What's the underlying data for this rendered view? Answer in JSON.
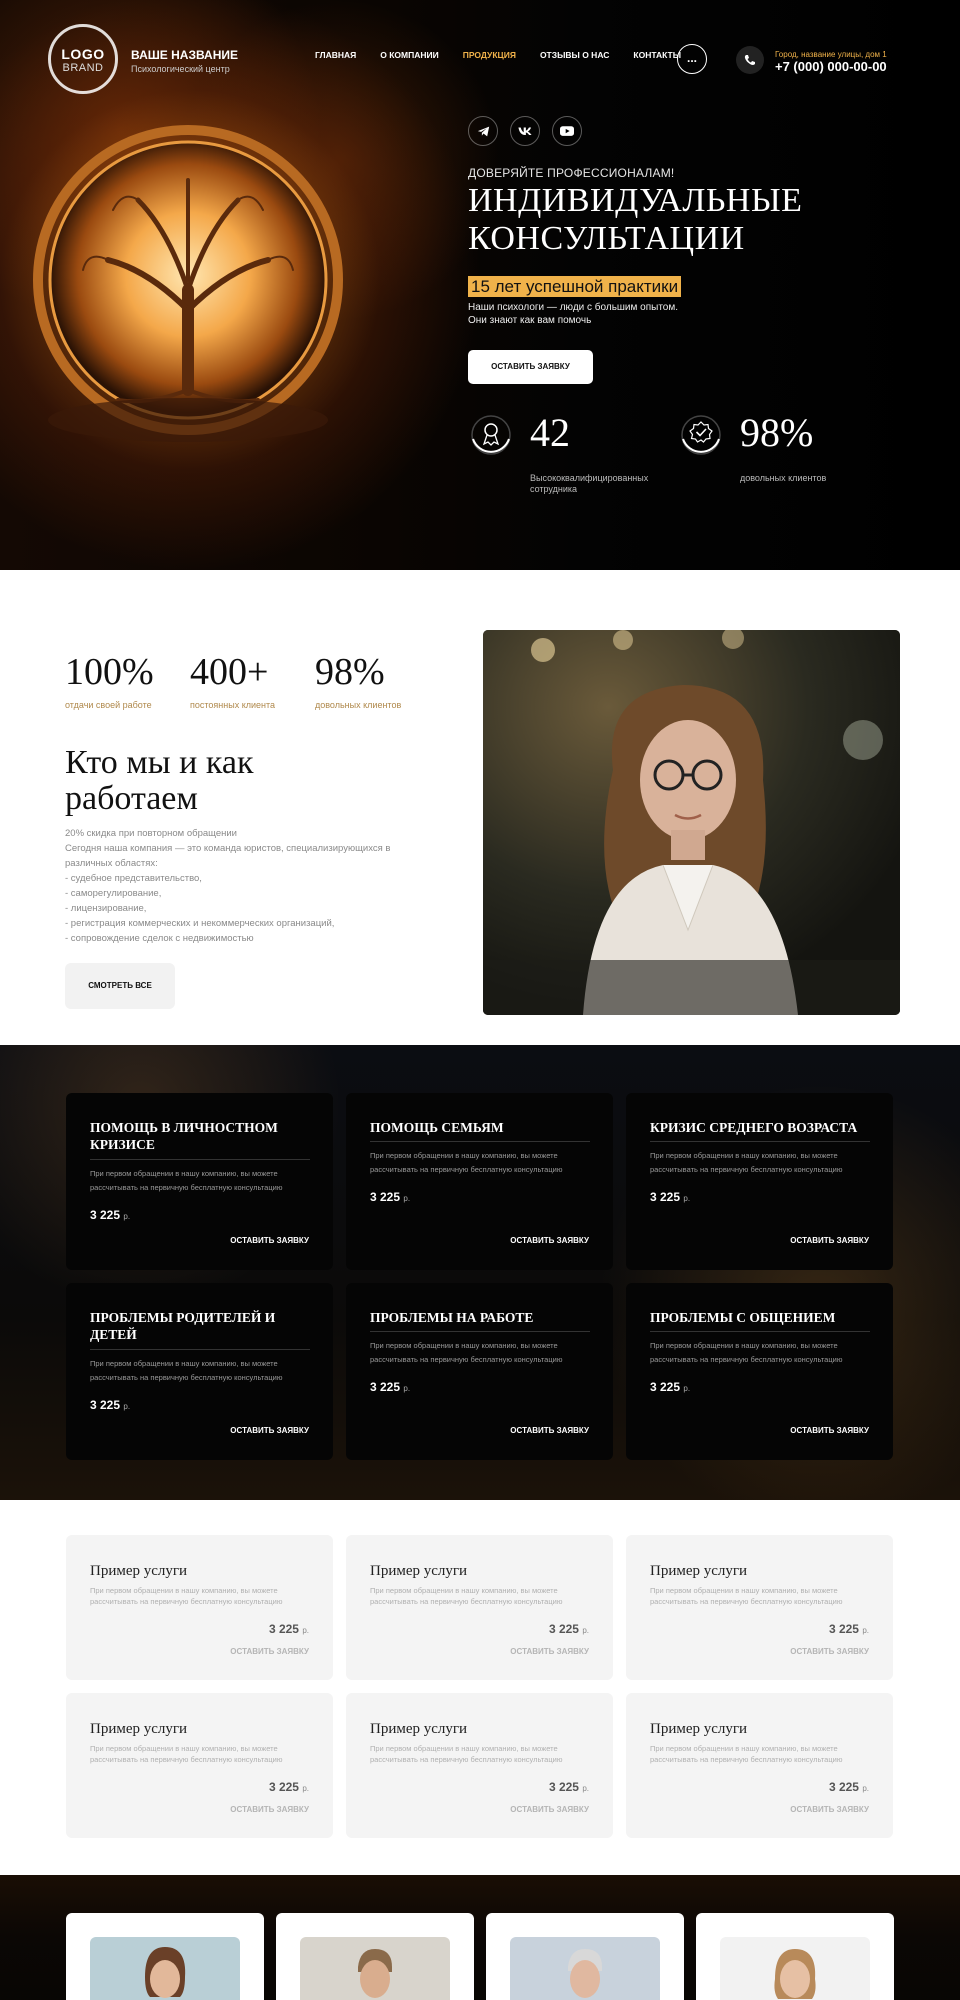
{
  "nav": {
    "logo_line1": "LOGO",
    "logo_line2": "BRAND",
    "brand_name": "ВАШЕ НАЗВАНИЕ",
    "brand_sub": "Психологический центр",
    "menu": [
      {
        "label": "ГЛАВНАЯ",
        "active": false
      },
      {
        "label": "О КОМПАНИИ",
        "active": false
      },
      {
        "label": "ПРОДУКЦИЯ",
        "active": true
      },
      {
        "label": "ОТЗЫВЫ О НАС",
        "active": false
      },
      {
        "label": "КОНТАКТЫ",
        "active": false
      }
    ],
    "more_label": "...",
    "address": "Город, название улицы, дом 1",
    "phone": "+7 (000) 000-00-00"
  },
  "hero": {
    "socials": [
      "telegram-icon",
      "vk-icon",
      "youtube-icon"
    ],
    "overline": "ДОВЕРЯЙТЕ ПРОФЕССИОНАЛАМ!",
    "title": "ИНДИВИДУАЛЬНЫЕ КОНСУЛЬТАЦИИ",
    "highlight": "15 лет успешной практики",
    "text_line1": "Наши психологи — люди с большим опытом.",
    "text_line2": "Они знают как вам помочь",
    "cta_label": "ОСТАВИТЬ ЗАЯВКУ",
    "stats": [
      {
        "value": "42",
        "label": "Высококвалифицированных сотрудника",
        "icon": "award-icon"
      },
      {
        "value": "98%",
        "label": "довольных клиентов",
        "icon": "check-badge-icon"
      }
    ]
  },
  "about": {
    "stats": [
      {
        "value": "100%",
        "label": "отдачи своей работе"
      },
      {
        "value": "400+",
        "label": "постоянных клиента"
      },
      {
        "value": "98%",
        "label": "довольных клиентов"
      }
    ],
    "title": "Кто мы и как работаем",
    "lines": [
      "20% скидка при повторном обращении",
      "Сегодня наша компания — это команда юристов, специализирующихся в различных областях:",
      "- судебное представительство,",
      "- саморегулирование,",
      "- лицензирование,",
      "- регистрация коммерческих и некоммерческих организаций,",
      "- сопровождение сделок с недвижимостью"
    ],
    "button_label": "СМОТРЕТЬ ВСЕ"
  },
  "dark_services": [
    {
      "title": "ПОМОЩЬ В ЛИЧНОСТНОМ КРИЗИСЕ",
      "desc": "При первом обращении в нашу компанию, вы можете рассчитывать на первичную бесплатную консультацию",
      "price": "3 225",
      "currency": "р.",
      "action": "ОСТАВИТЬ ЗАЯВКУ"
    },
    {
      "title": "ПОМОЩЬ СЕМЬЯМ",
      "desc": "При первом обращении в нашу компанию, вы можете рассчитывать на первичную бесплатную консультацию",
      "price": "3 225",
      "currency": "р.",
      "action": "ОСТАВИТЬ ЗАЯВКУ"
    },
    {
      "title": "КРИЗИС СРЕДНЕГО ВОЗРАСТА",
      "desc": "При первом обращении в нашу компанию, вы можете рассчитывать на первичную бесплатную консультацию",
      "price": "3 225",
      "currency": "р.",
      "action": "ОСТАВИТЬ ЗАЯВКУ"
    },
    {
      "title": "ПРОБЛЕМЫ РОДИТЕЛЕЙ И ДЕТЕЙ",
      "desc": "При первом обращении в нашу компанию, вы можете рассчитывать на первичную бесплатную консультацию",
      "price": "3 225",
      "currency": "р.",
      "action": "ОСТАВИТЬ ЗАЯВКУ"
    },
    {
      "title": "ПРОБЛЕМЫ НА РАБОТЕ",
      "desc": "При первом обращении в нашу компанию, вы можете рассчитывать на первичную бесплатную консультацию",
      "price": "3 225",
      "currency": "р.",
      "action": "ОСТАВИТЬ ЗАЯВКУ"
    },
    {
      "title": "ПРОБЛЕМЫ С ОБЩЕНИЕМ",
      "desc": "При первом обращении в нашу компанию, вы можете рассчитывать на первичную бесплатную консультацию",
      "price": "3 225",
      "currency": "р.",
      "action": "ОСТАВИТЬ ЗАЯВКУ"
    }
  ],
  "light_services": [
    {
      "title": "Пример услуги",
      "desc": "При первом обращении в нашу компанию, вы можете рассчитывать на первичную бесплатную консультацию",
      "price": "3 225",
      "currency": "р.",
      "action": "ОСТАВИТЬ ЗАЯВКУ"
    },
    {
      "title": "Пример услуги",
      "desc": "При первом обращении в нашу компанию, вы можете рассчитывать на первичную бесплатную консультацию",
      "price": "3 225",
      "currency": "р.",
      "action": "ОСТАВИТЬ ЗАЯВКУ"
    },
    {
      "title": "Пример услуги",
      "desc": "При первом обращении в нашу компанию, вы можете рассчитывать на первичную бесплатную консультацию",
      "price": "3 225",
      "currency": "р.",
      "action": "ОСТАВИТЬ ЗАЯВКУ"
    },
    {
      "title": "Пример услуги",
      "desc": "При первом обращении в нашу компанию, вы можете рассчитывать на первичную бесплатную консультацию",
      "price": "3 225",
      "currency": "р.",
      "action": "ОСТАВИТЬ ЗАЯВКУ"
    },
    {
      "title": "Пример услуги",
      "desc": "При первом обращении в нашу компанию, вы можете рассчитывать на первичную бесплатную консультацию",
      "price": "3 225",
      "currency": "р.",
      "action": "ОСТАВИТЬ ЗАЯВКУ"
    },
    {
      "title": "Пример услуги",
      "desc": "При первом обращении в нашу компанию, вы можете рассчитывать на первичную бесплатную консультацию",
      "price": "3 225",
      "currency": "р.",
      "action": "ОСТАВИТЬ ЗАЯВКУ"
    }
  ],
  "colors": {
    "accent": "#f0b24a",
    "label_gold": "#b0894c",
    "dark_card": "#050505",
    "light_card": "#f4f4f4"
  }
}
